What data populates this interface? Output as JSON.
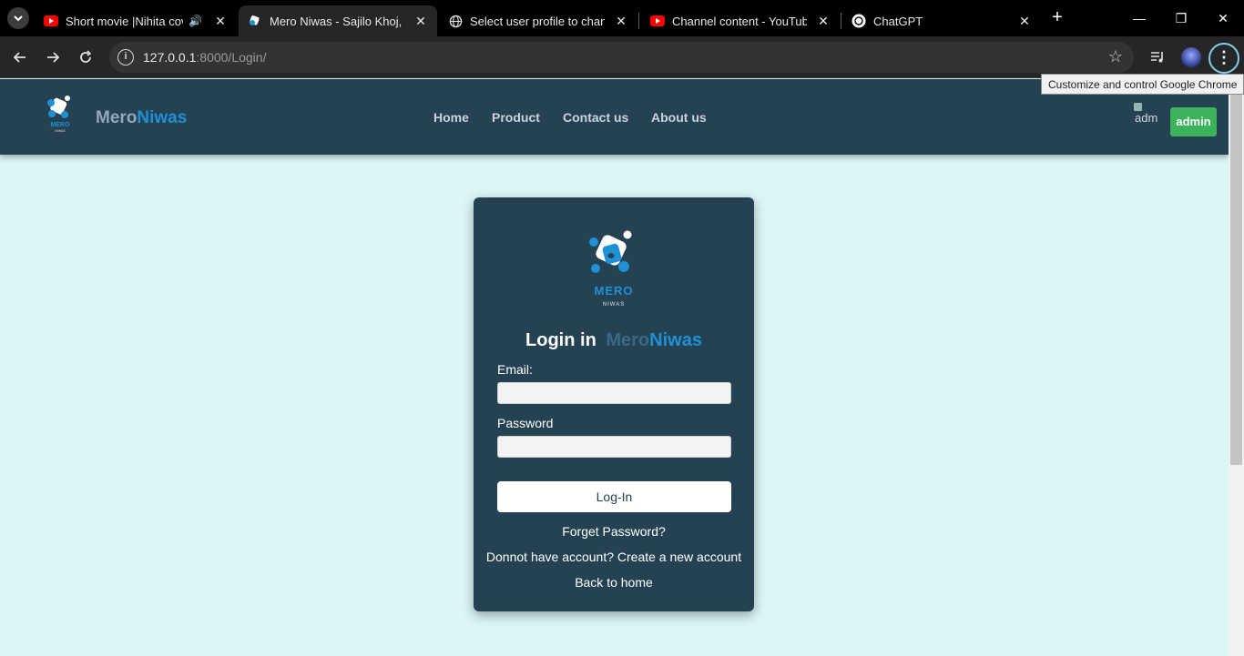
{
  "browser": {
    "tabs": [
      {
        "title": "Short movie |Nihita cove",
        "favicon": "youtube-icon",
        "audio": true
      },
      {
        "title": "Mero Niwas - Sajilo Khoj, Saj",
        "favicon": "meroniwas-favicon",
        "active": true
      },
      {
        "title": "Select user profile to change",
        "favicon": "globe-icon"
      },
      {
        "title": "Channel content - YouTube S",
        "favicon": "youtube-icon"
      },
      {
        "title": "ChatGPT",
        "favicon": "chatgpt-icon"
      }
    ],
    "url_host": "127.0.0.1",
    "url_path": ":8000/Login/",
    "tooltip": "Customize and control Google Chrome"
  },
  "site": {
    "brand_mero": "Mero",
    "brand_niwas": "Niwas",
    "nav": [
      "Home",
      "Product",
      "Contact us",
      "About us"
    ],
    "avatar_alt": "adm",
    "admin_label": "admin"
  },
  "login": {
    "logo_text_top": "MERO",
    "logo_text_bottom": "NIWAS",
    "title_prefix": "Login in",
    "title_mero": "Mero",
    "title_niwas": "Niwas",
    "email_label": "Email:",
    "email_value": "",
    "password_label": "Password",
    "password_value": "",
    "submit_label": "Log-In",
    "forgot_label": "Forget Password?",
    "signup_label": "Donnot have account? Create a new account",
    "back_label": "Back to home"
  },
  "colors": {
    "page_bg": "#dcf5f7",
    "header_bg": "#254252",
    "card_bg": "#254252",
    "brand_blue": "#1e90d6",
    "admin_green": "#3cb35b"
  }
}
